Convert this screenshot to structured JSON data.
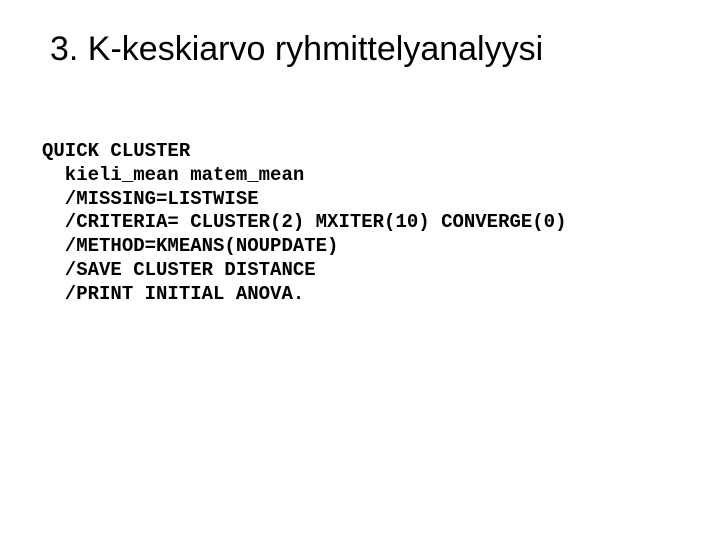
{
  "title": "3. K-keskiarvo ryhmittelyanalyysi",
  "code": "QUICK CLUSTER\n  kieli_mean matem_mean\n  /MISSING=LISTWISE\n  /CRITERIA= CLUSTER(2) MXITER(10) CONVERGE(0)\n  /METHOD=KMEANS(NOUPDATE)\n  /SAVE CLUSTER DISTANCE\n  /PRINT INITIAL ANOVA."
}
